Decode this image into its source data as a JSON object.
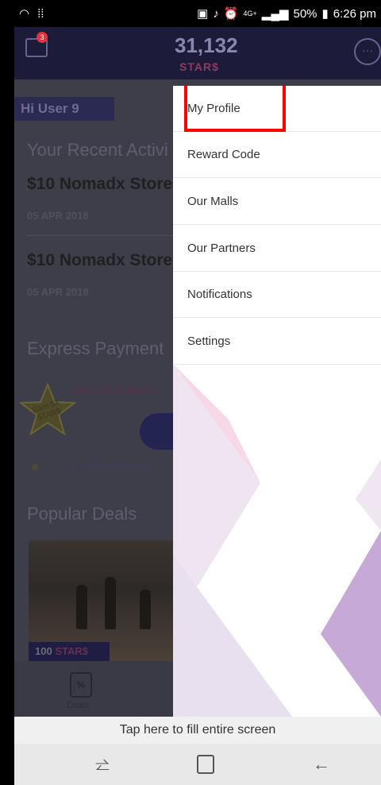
{
  "status_bar": {
    "left_icons": [
      "wifi-icon",
      "grid-dots-icon"
    ],
    "network": "4G+",
    "battery": "50%",
    "time": "6:26 pm"
  },
  "header": {
    "badge_count": "3",
    "stars_amount": "31,132",
    "stars_unit": "STAR$"
  },
  "background": {
    "greeting": "Hi User 9",
    "recent_title": "Your Recent Activi",
    "activities": [
      {
        "title": "$10 Nomadx Store",
        "date": "05 APR 2018"
      },
      {
        "title": "$10 Nomadx Store",
        "date": "05 APR 2018"
      }
    ],
    "express_title": "Express Payment",
    "star_badge": "Earn 5X STAR$",
    "earn_text": "Earn 5X STAR$ fo",
    "coming_text": "Coming soon on",
    "popular_title": "Popular Deals",
    "deal_stars": "100",
    "deal_unit": "STAR$",
    "tab_deals": "Deals"
  },
  "drawer": {
    "items": [
      {
        "label": "My Profile"
      },
      {
        "label": "Reward Code"
      },
      {
        "label": "Our Malls"
      },
      {
        "label": "Our Partners"
      },
      {
        "label": "Notifications"
      },
      {
        "label": "Settings"
      }
    ]
  },
  "fullscreen_prompt": "Tap here to fill entire screen",
  "colors": {
    "header_bg": "#1d1b3a",
    "highlight": "#ff0000",
    "drawer_bg": "#ffffff"
  }
}
